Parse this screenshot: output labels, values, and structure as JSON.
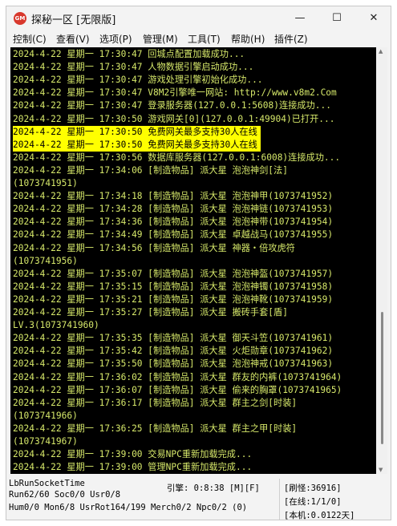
{
  "window": {
    "title": "探秘一区 [无限版]",
    "icon_label": "GM"
  },
  "titlebar": {
    "min_glyph": "—",
    "max_glyph": "☐",
    "close_glyph": "✕"
  },
  "menu": [
    "控制(C)",
    "查看(V)",
    "选项(P)",
    "管理(M)",
    "工具(T)",
    "帮助(H)",
    "插件(Z)"
  ],
  "log": [
    {
      "text": "2024-4-22 星期一 17:30:47 回城点配置加载成功...",
      "highlight": false
    },
    {
      "text": "2024-4-22 星期一 17:30:47 人物数据引擎启动成功...",
      "highlight": false
    },
    {
      "text": "2024-4-22 星期一 17:30:47 游戏处理引擎初始化成功...",
      "highlight": false
    },
    {
      "text": "2024-4-22 星期一 17:30:47 V8M2引擎唯一网站: http://www.v8m2.Com",
      "highlight": false
    },
    {
      "text": "2024-4-22 星期一 17:30:47 登录服务器(127.0.0.1:5608)连接成功...",
      "highlight": false
    },
    {
      "text": "2024-4-22 星期一 17:30:50 游戏网关[0](127.0.0.1:49904)已打开...",
      "highlight": false
    },
    {
      "text": "2024-4-22 星期一 17:30:50 免费网关最多支持30人在线",
      "highlight": true
    },
    {
      "text": "2024-4-22 星期一 17:30:50 免费网关最多支持30人在线",
      "highlight": true
    },
    {
      "text": "2024-4-22 星期一 17:30:56 数据库服务器(127.0.0.1:6008)连接成功...",
      "highlight": false
    },
    {
      "text": "2024-4-22 星期一 17:34:06 [制造物品] 派大星 泡泡神剑[法]",
      "highlight": false
    },
    {
      "text": "(1073741951)",
      "highlight": false
    },
    {
      "text": "2024-4-22 星期一 17:34:18 [制造物品] 派大星 泡泡神甲(1073741952)",
      "highlight": false
    },
    {
      "text": "2024-4-22 星期一 17:34:28 [制造物品] 派大星 泡泡神链(1073741953)",
      "highlight": false
    },
    {
      "text": "2024-4-22 星期一 17:34:36 [制造物品] 派大星 泡泡神带(1073741954)",
      "highlight": false
    },
    {
      "text": "2024-4-22 星期一 17:34:49 [制造物品] 派大星 卓越战马(1073741955)",
      "highlight": false
    },
    {
      "text": "2024-4-22 星期一 17:34:56 [制造物品] 派大星 神器・倍攻虎符",
      "highlight": false
    },
    {
      "text": "(1073741956)",
      "highlight": false
    },
    {
      "text": "2024-4-22 星期一 17:35:07 [制造物品] 派大星 泡泡神盔(1073741957)",
      "highlight": false
    },
    {
      "text": "2024-4-22 星期一 17:35:15 [制造物品] 派大星 泡泡神镯(1073741958)",
      "highlight": false
    },
    {
      "text": "2024-4-22 星期一 17:35:21 [制造物品] 派大星 泡泡神靴(1073741959)",
      "highlight": false
    },
    {
      "text": "2024-4-22 星期一 17:35:27 [制造物品] 派大星 搬砖手套[盾]",
      "highlight": false
    },
    {
      "text": "LV.3(1073741960)",
      "highlight": false
    },
    {
      "text": "2024-4-22 星期一 17:35:35 [制造物品] 派大星 御天斗笠(1073741961)",
      "highlight": false
    },
    {
      "text": "2024-4-22 星期一 17:35:42 [制造物品] 派大星 火炬勋章(1073741962)",
      "highlight": false
    },
    {
      "text": "2024-4-22 星期一 17:35:50 [制造物品] 派大星 泡泡神戒(1073741963)",
      "highlight": false
    },
    {
      "text": "2024-4-22 星期一 17:36:02 [制造物品] 派大星 群友的内裤(1073741964)",
      "highlight": false
    },
    {
      "text": "2024-4-22 星期一 17:36:07 [制造物品] 派大星 偷来的胸罩(1073741965)",
      "highlight": false
    },
    {
      "text": "2024-4-22 星期一 17:36:17 [制造物品] 派大星 群主之剑[时装]",
      "highlight": false
    },
    {
      "text": "(1073741966)",
      "highlight": false
    },
    {
      "text": "2024-4-22 星期一 17:36:25 [制造物品] 派大星 群主之甲[时装]",
      "highlight": false
    },
    {
      "text": "(1073741967)",
      "highlight": false
    },
    {
      "text": "2024-4-22 星期一 17:39:00 交易NPC重新加载完成...",
      "highlight": false
    },
    {
      "text": "2024-4-22 星期一 17:39:00 管理NPC重新加载完成...",
      "highlight": false
    }
  ],
  "status": {
    "line1": "LbRunSocketTime",
    "line2": "Run62/60 Soc0/0 Usr0/8",
    "line3": "Hum0/0 Mon6/8 UsrRot164/199 Merch0/2 Npc0/2 (0)",
    "line4": "",
    "engine": "引擎: 0:8:38 [M][F]",
    "refresh": "[刷怪:36916]",
    "online": "[在线:1/1/0]",
    "version": "[本机:0.0122天]"
  }
}
